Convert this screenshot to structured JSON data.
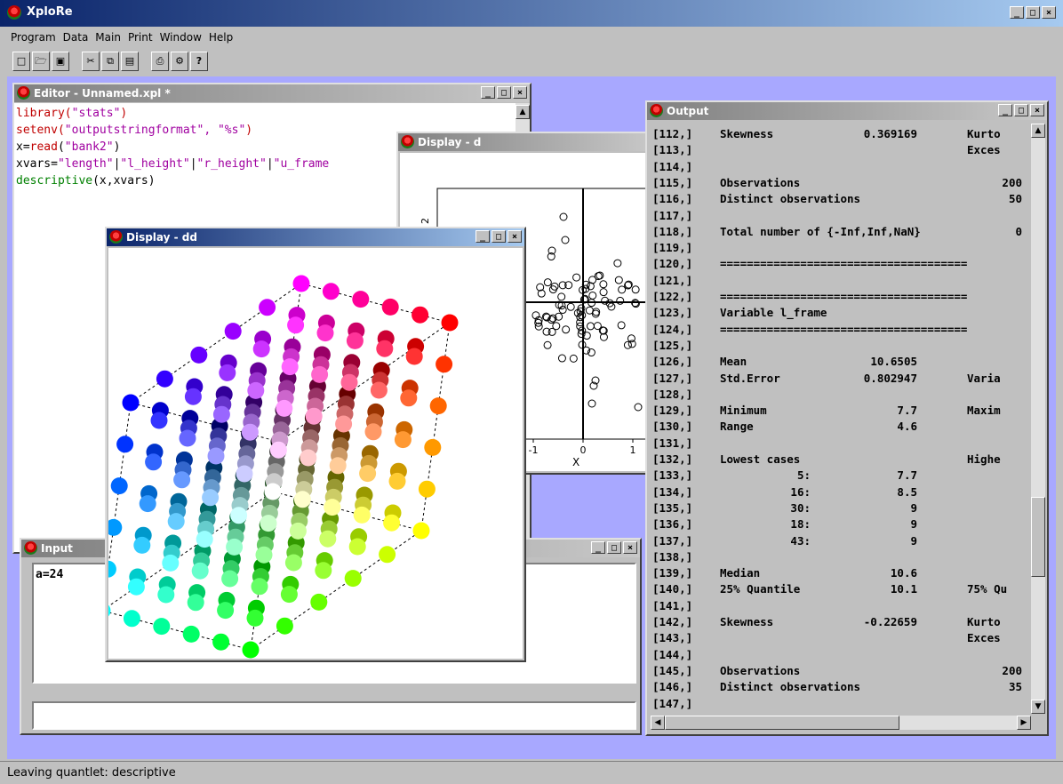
{
  "app": {
    "title": "XploRe"
  },
  "menu": [
    "Program",
    "Data",
    "Main",
    "Print",
    "Window",
    "Help"
  ],
  "toolbar_icons": [
    "new-file-icon",
    "open-folder-icon",
    "save-icon",
    "cut-icon",
    "copy-icon",
    "paste-icon",
    "print-icon",
    "settings-icon",
    "help-icon"
  ],
  "window_buttons": {
    "minimize": "_",
    "maximize": "□",
    "close": "×"
  },
  "editor": {
    "title": "Editor - Unnamed.xpl *",
    "lines": [
      [
        {
          "t": "library(",
          "c": "fn"
        },
        {
          "t": "\"stats\"",
          "c": "str"
        },
        {
          "t": ")",
          "c": "fn"
        }
      ],
      [
        {
          "t": "setenv(",
          "c": "fn"
        },
        {
          "t": "\"outputstringformat\", \"%s\"",
          "c": "str"
        },
        {
          "t": ")",
          "c": "fn"
        }
      ],
      [
        {
          "t": "x=",
          "c": ""
        },
        {
          "t": "read",
          "c": "fn"
        },
        {
          "t": "(",
          "c": ""
        },
        {
          "t": "\"bank2\"",
          "c": "str"
        },
        {
          "t": ")",
          "c": ""
        }
      ],
      [
        {
          "t": "xvars=",
          "c": ""
        },
        {
          "t": "\"length\"",
          "c": "str"
        },
        {
          "t": "|",
          "c": ""
        },
        {
          "t": "\"l_height\"",
          "c": "str"
        },
        {
          "t": "|",
          "c": ""
        },
        {
          "t": "\"r_height\"",
          "c": "str"
        },
        {
          "t": "|",
          "c": ""
        },
        {
          "t": "\"u_frame",
          "c": "str"
        }
      ],
      [
        {
          "t": "descriptive",
          "c": "gr"
        },
        {
          "t": "(x,xvars)",
          "c": ""
        }
      ]
    ]
  },
  "display_d": {
    "title": "Display - d",
    "xlabel": "X",
    "xticks": [
      "-1",
      "0",
      "1"
    ],
    "yticks": [
      "2"
    ]
  },
  "display_dd": {
    "title": "Display - dd"
  },
  "input": {
    "title": "Input",
    "text": "a=24",
    "command_value": ""
  },
  "output": {
    "title": "Output",
    "rows": [
      [
        "[112,]",
        "Skewness",
        "0.369169",
        "Kurto"
      ],
      [
        "[113,]",
        "",
        "",
        "Exces"
      ],
      [
        "[114,]",
        "",
        "",
        ""
      ],
      [
        "[115,]",
        "Observations",
        "",
        "200"
      ],
      [
        "[116,]",
        "Distinct observations",
        "",
        "50"
      ],
      [
        "[117,]",
        "",
        "",
        ""
      ],
      [
        "[118,]",
        "Total number of {-Inf,Inf,NaN}",
        "",
        "0"
      ],
      [
        "[119,]",
        "",
        "",
        ""
      ],
      [
        "[120,]",
        "=====================================",
        "",
        ""
      ],
      [
        "[121,]",
        "",
        "",
        ""
      ],
      [
        "[122,]",
        "=====================================",
        "",
        ""
      ],
      [
        "[123,]",
        "Variable l_frame",
        "",
        ""
      ],
      [
        "[124,]",
        "=====================================",
        "",
        ""
      ],
      [
        "[125,]",
        "",
        "",
        ""
      ],
      [
        "[126,]",
        "Mean",
        "10.6505",
        ""
      ],
      [
        "[127,]",
        "Std.Error",
        "0.802947",
        "Varia"
      ],
      [
        "[128,]",
        "",
        "",
        ""
      ],
      [
        "[129,]",
        "Minimum",
        "7.7",
        "Maxim"
      ],
      [
        "[130,]",
        "Range",
        "4.6",
        ""
      ],
      [
        "[131,]",
        "",
        "",
        ""
      ],
      [
        "[132,]",
        "Lowest cases",
        "",
        "Highe"
      ],
      [
        "[133,]",
        "5:",
        "7.7",
        ""
      ],
      [
        "[134,]",
        "16:",
        "8.5",
        ""
      ],
      [
        "[135,]",
        "30:",
        "9",
        ""
      ],
      [
        "[136,]",
        "18:",
        "9",
        ""
      ],
      [
        "[137,]",
        "43:",
        "9",
        ""
      ],
      [
        "[138,]",
        "",
        "",
        ""
      ],
      [
        "[139,]",
        "Median",
        "10.6",
        ""
      ],
      [
        "[140,]",
        "25% Quantile",
        "10.1",
        "75% Qu"
      ],
      [
        "[141,]",
        "",
        "",
        ""
      ],
      [
        "[142,]",
        "Skewness",
        "-0.22659",
        "Kurto"
      ],
      [
        "[143,]",
        "",
        "",
        "Exces"
      ],
      [
        "[144,]",
        "",
        "",
        ""
      ],
      [
        "[145,]",
        "Observations",
        "",
        "200"
      ],
      [
        "[146,]",
        "Distinct observations",
        "",
        "35"
      ],
      [
        "[147,]",
        "",
        "",
        ""
      ]
    ]
  },
  "status": {
    "text": "Leaving quantlet: descriptive"
  }
}
